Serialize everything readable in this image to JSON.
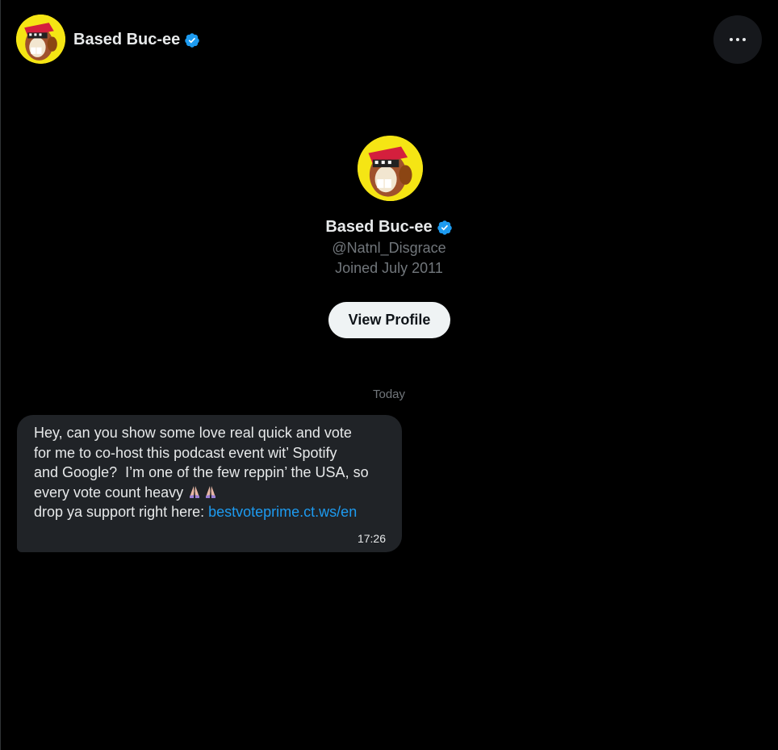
{
  "header": {
    "display_name": "Based Buc-ee",
    "avatar_icon": "beaver-mascot-avatar",
    "verified_icon": "verified-badge-icon",
    "more_icon": "more-options-icon"
  },
  "profile": {
    "display_name": "Based Buc-ee",
    "handle": "@Natnl_Disgrace",
    "joined": "Joined July 2011",
    "view_profile_label": "View Profile"
  },
  "conversation": {
    "date_divider": "Today",
    "messages": [
      {
        "line1": "Hey, can you show some love real quick and vote",
        "line2": "for me to co-host this podcast event wit’ Spotify",
        "line3": "and Google?  I’m one of the few reppin’ the USA, so",
        "line4": "every vote count heavy ",
        "emoji": "🙏🏻 🙏🏻",
        "line5": "drop ya support right here: ",
        "link": "bestvoteprime.ct.ws/en",
        "time": "17:26"
      }
    ]
  },
  "colors": {
    "background": "#000000",
    "bubble": "#202327",
    "link": "#1d9bf0",
    "verified": "#1d9bf0",
    "secondary_text": "#71767b",
    "button_bg": "#eff3f4"
  }
}
